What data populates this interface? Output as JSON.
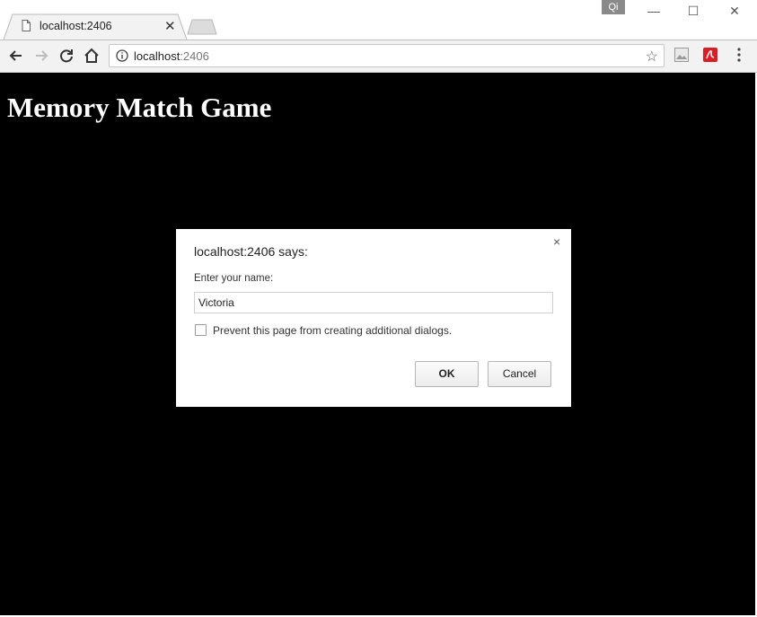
{
  "browser": {
    "tab_title": "localhost:2406",
    "address_host": "localhost",
    "address_port": ":2406",
    "extension_badge": "Qi",
    "window_controls": {
      "minimize": "—",
      "maximize": "☐",
      "close": "✕"
    }
  },
  "page": {
    "heading": "Memory Match Game",
    "background": "#000000"
  },
  "dialog": {
    "title": "localhost:2406 says:",
    "prompt_label": "Enter your name:",
    "input_value": "Victoria",
    "checkbox_label": "Prevent this page from creating additional dialogs.",
    "ok_label": "OK",
    "cancel_label": "Cancel",
    "close_glyph": "×"
  },
  "icons": {
    "tab": "page-icon",
    "back": "back-arrow-icon",
    "forward": "forward-arrow-icon",
    "reload": "reload-icon",
    "home": "home-icon",
    "info": "info-icon",
    "bookmark": "star-icon",
    "ext1": "image-extension-icon",
    "ext2": "acrobat-extension-icon",
    "menu": "menu-dots-icon"
  }
}
